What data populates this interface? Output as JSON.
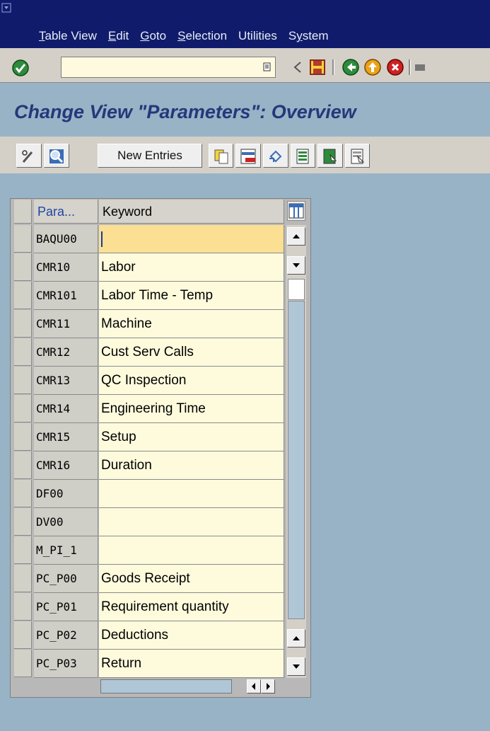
{
  "menu": [
    "Table View",
    "Edit",
    "Goto",
    "Selection",
    "Utilities",
    "System"
  ],
  "menu_underline": [
    "T",
    "E",
    "G",
    "S",
    "",
    "y"
  ],
  "command_field": {
    "value": ""
  },
  "page_title": "Change View \"Parameters\": Overview",
  "app_toolbar": {
    "new_entries_label": "New Entries"
  },
  "table": {
    "headers": {
      "param": "Para...",
      "keyword": "Keyword"
    },
    "rows": [
      {
        "param": "BAQU00",
        "keyword": ""
      },
      {
        "param": "CMR10",
        "keyword": "Labor"
      },
      {
        "param": "CMR101",
        "keyword": "Labor Time - Temp"
      },
      {
        "param": "CMR11",
        "keyword": "Machine"
      },
      {
        "param": "CMR12",
        "keyword": "Cust Serv Calls"
      },
      {
        "param": "CMR13",
        "keyword": "QC Inspection"
      },
      {
        "param": "CMR14",
        "keyword": "Engineering Time"
      },
      {
        "param": "CMR15",
        "keyword": "Setup"
      },
      {
        "param": "CMR16",
        "keyword": "Duration"
      },
      {
        "param": "DF00",
        "keyword": ""
      },
      {
        "param": "DV00",
        "keyword": ""
      },
      {
        "param": "M_PI_1",
        "keyword": ""
      },
      {
        "param": "PC_P00",
        "keyword": "Goods Receipt"
      },
      {
        "param": "PC_P01",
        "keyword": "Requirement quantity"
      },
      {
        "param": "PC_P02",
        "keyword": "Deductions"
      },
      {
        "param": "PC_P03",
        "keyword": "Return"
      }
    ]
  },
  "colors": {
    "title_bar": "#101c6b",
    "background": "#98b3c6",
    "title_text": "#24387a",
    "input_bg": "#fefbdd",
    "active_row": "#fbdf93"
  }
}
